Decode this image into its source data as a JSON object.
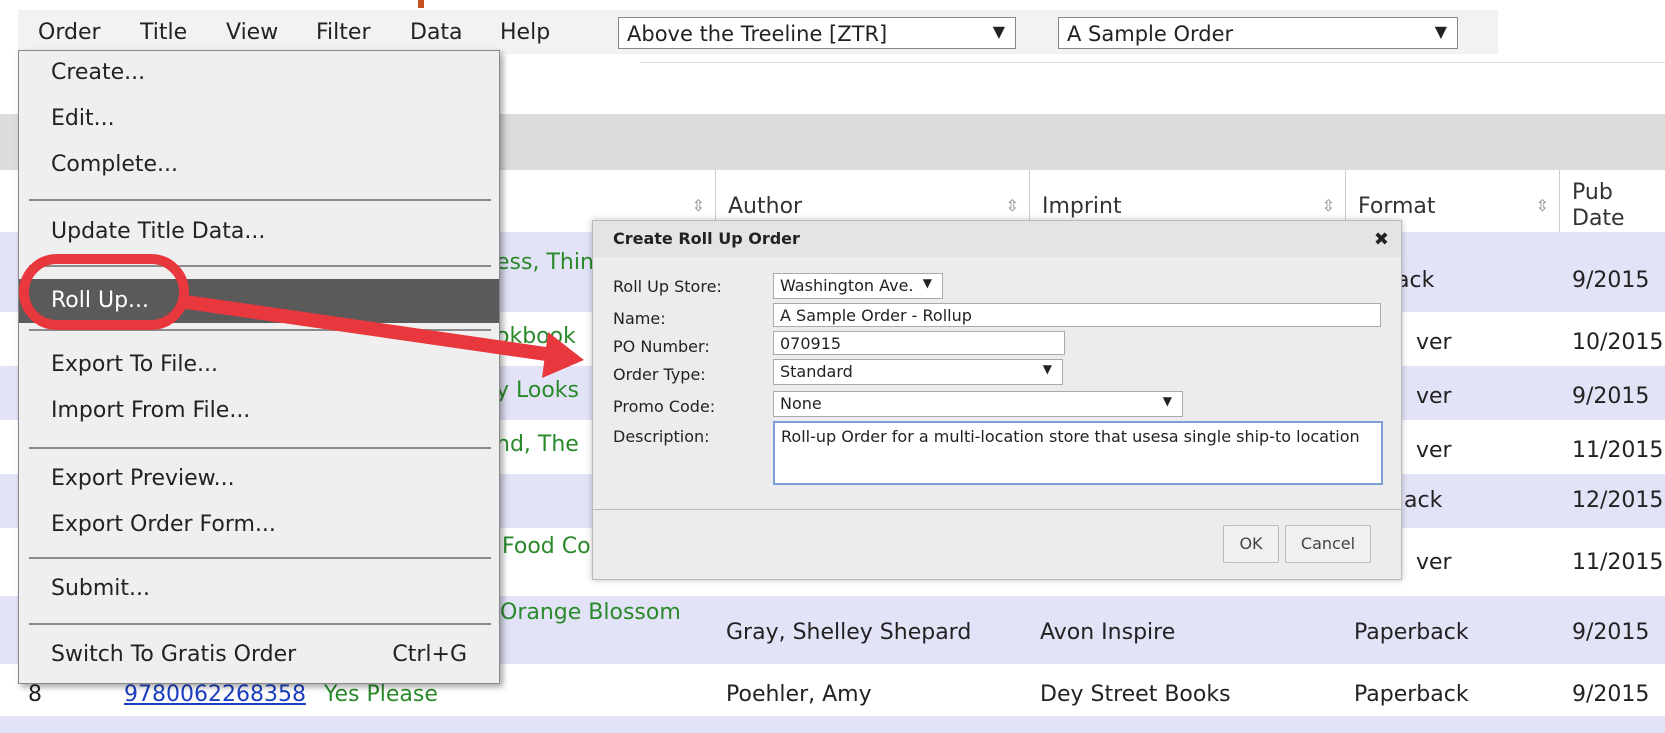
{
  "menubar": {
    "items": [
      "Order",
      "Title",
      "View",
      "Filter",
      "Data",
      "Help"
    ],
    "store_select": "Above the Treeline [ZTR]",
    "order_select": "A Sample Order"
  },
  "grid": {
    "headers": {
      "author": "Author",
      "imprint": "Imprint",
      "format": "Format",
      "pub_date_1": "Pub",
      "pub_date_2": "Date"
    },
    "rows": [
      {
        "title": "ess, Think",
        "author": "",
        "imprint": "",
        "format": "ack",
        "pub": "9/2015"
      },
      {
        "title": "okbook",
        "author": "",
        "imprint": "",
        "format": "ver",
        "pub": "10/2015"
      },
      {
        "title": "y Looks",
        "author": "",
        "imprint": "",
        "format": "ver",
        "pub": "9/2015"
      },
      {
        "title": "nd, The",
        "author": "",
        "imprint": "",
        "format": "ver",
        "pub": "11/2015"
      },
      {
        "title": "",
        "author": "",
        "imprint": "",
        "format": "ack",
        "pub": "12/2015"
      },
      {
        "title": "Food Co",
        "author": "",
        "imprint": "",
        "format": "ver",
        "pub": "11/2015"
      },
      {
        "title": "Orange Blossom",
        "author": "Gray, Shelley Shepard",
        "imprint": "Avon Inspire",
        "format": "Paperback",
        "pub": "9/2015"
      },
      {
        "num": "8",
        "isbn": "9780062268358",
        "title": "Yes Please",
        "author": "Poehler, Amy",
        "imprint": "Dey Street Books",
        "format": "Paperback",
        "pub": "9/2015"
      }
    ]
  },
  "menu": {
    "create": "Create...",
    "edit": "Edit...",
    "complete": "Complete...",
    "update_title_data": "Update Title Data...",
    "roll_up": "Roll Up...",
    "export_to_file": "Export To File...",
    "import_from_file": "Import From File...",
    "export_preview": "Export Preview...",
    "export_order_form": "Export Order Form...",
    "submit": "Submit...",
    "switch_gratis": "Switch To Gratis Order",
    "switch_gratis_shortcut": "Ctrl+G"
  },
  "dialog": {
    "title": "Create Roll Up Order",
    "close_icon": "close-icon",
    "labels": {
      "store": "Roll Up Store:",
      "name": "Name:",
      "po": "PO Number:",
      "order_type": "Order Type:",
      "promo": "Promo Code:",
      "description": "Description:"
    },
    "values": {
      "store": "Washington Ave.",
      "name": "A Sample Order - Rollup",
      "po": "070915",
      "order_type": "Standard",
      "promo": "None",
      "description": "Roll-up Order for a multi-location store that usesa single ship-to location"
    },
    "ok": "OK",
    "cancel": "Cancel"
  },
  "colors": {
    "annotation": "#e8383d",
    "row_alt": "#e3e3f8",
    "menu_active": "#5a5a5a",
    "title_green": "#2a8a2a"
  }
}
